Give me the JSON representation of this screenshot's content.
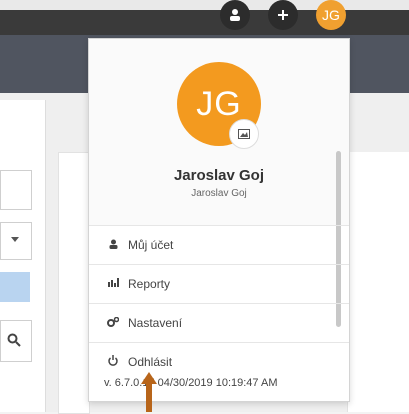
{
  "header": {
    "avatar_initials": "JG"
  },
  "profile": {
    "initials": "JG",
    "full_name": "Jaroslav Goj",
    "username": "Jaroslav Goj",
    "avatar_color": "#f39a1f"
  },
  "menu": {
    "items": [
      {
        "label": "Můj účet",
        "icon": "user-icon"
      },
      {
        "label": "Reporty",
        "icon": "bar-chart-icon"
      },
      {
        "label": "Nastavení",
        "icon": "gears-icon"
      },
      {
        "label": "Odhlásit",
        "icon": "power-icon"
      }
    ]
  },
  "version": "v. 6.7.0.17 04/30/2019 10:19:47 AM",
  "colors": {
    "accent": "#f39a1f",
    "annotation_arrow": "#b8651a"
  }
}
